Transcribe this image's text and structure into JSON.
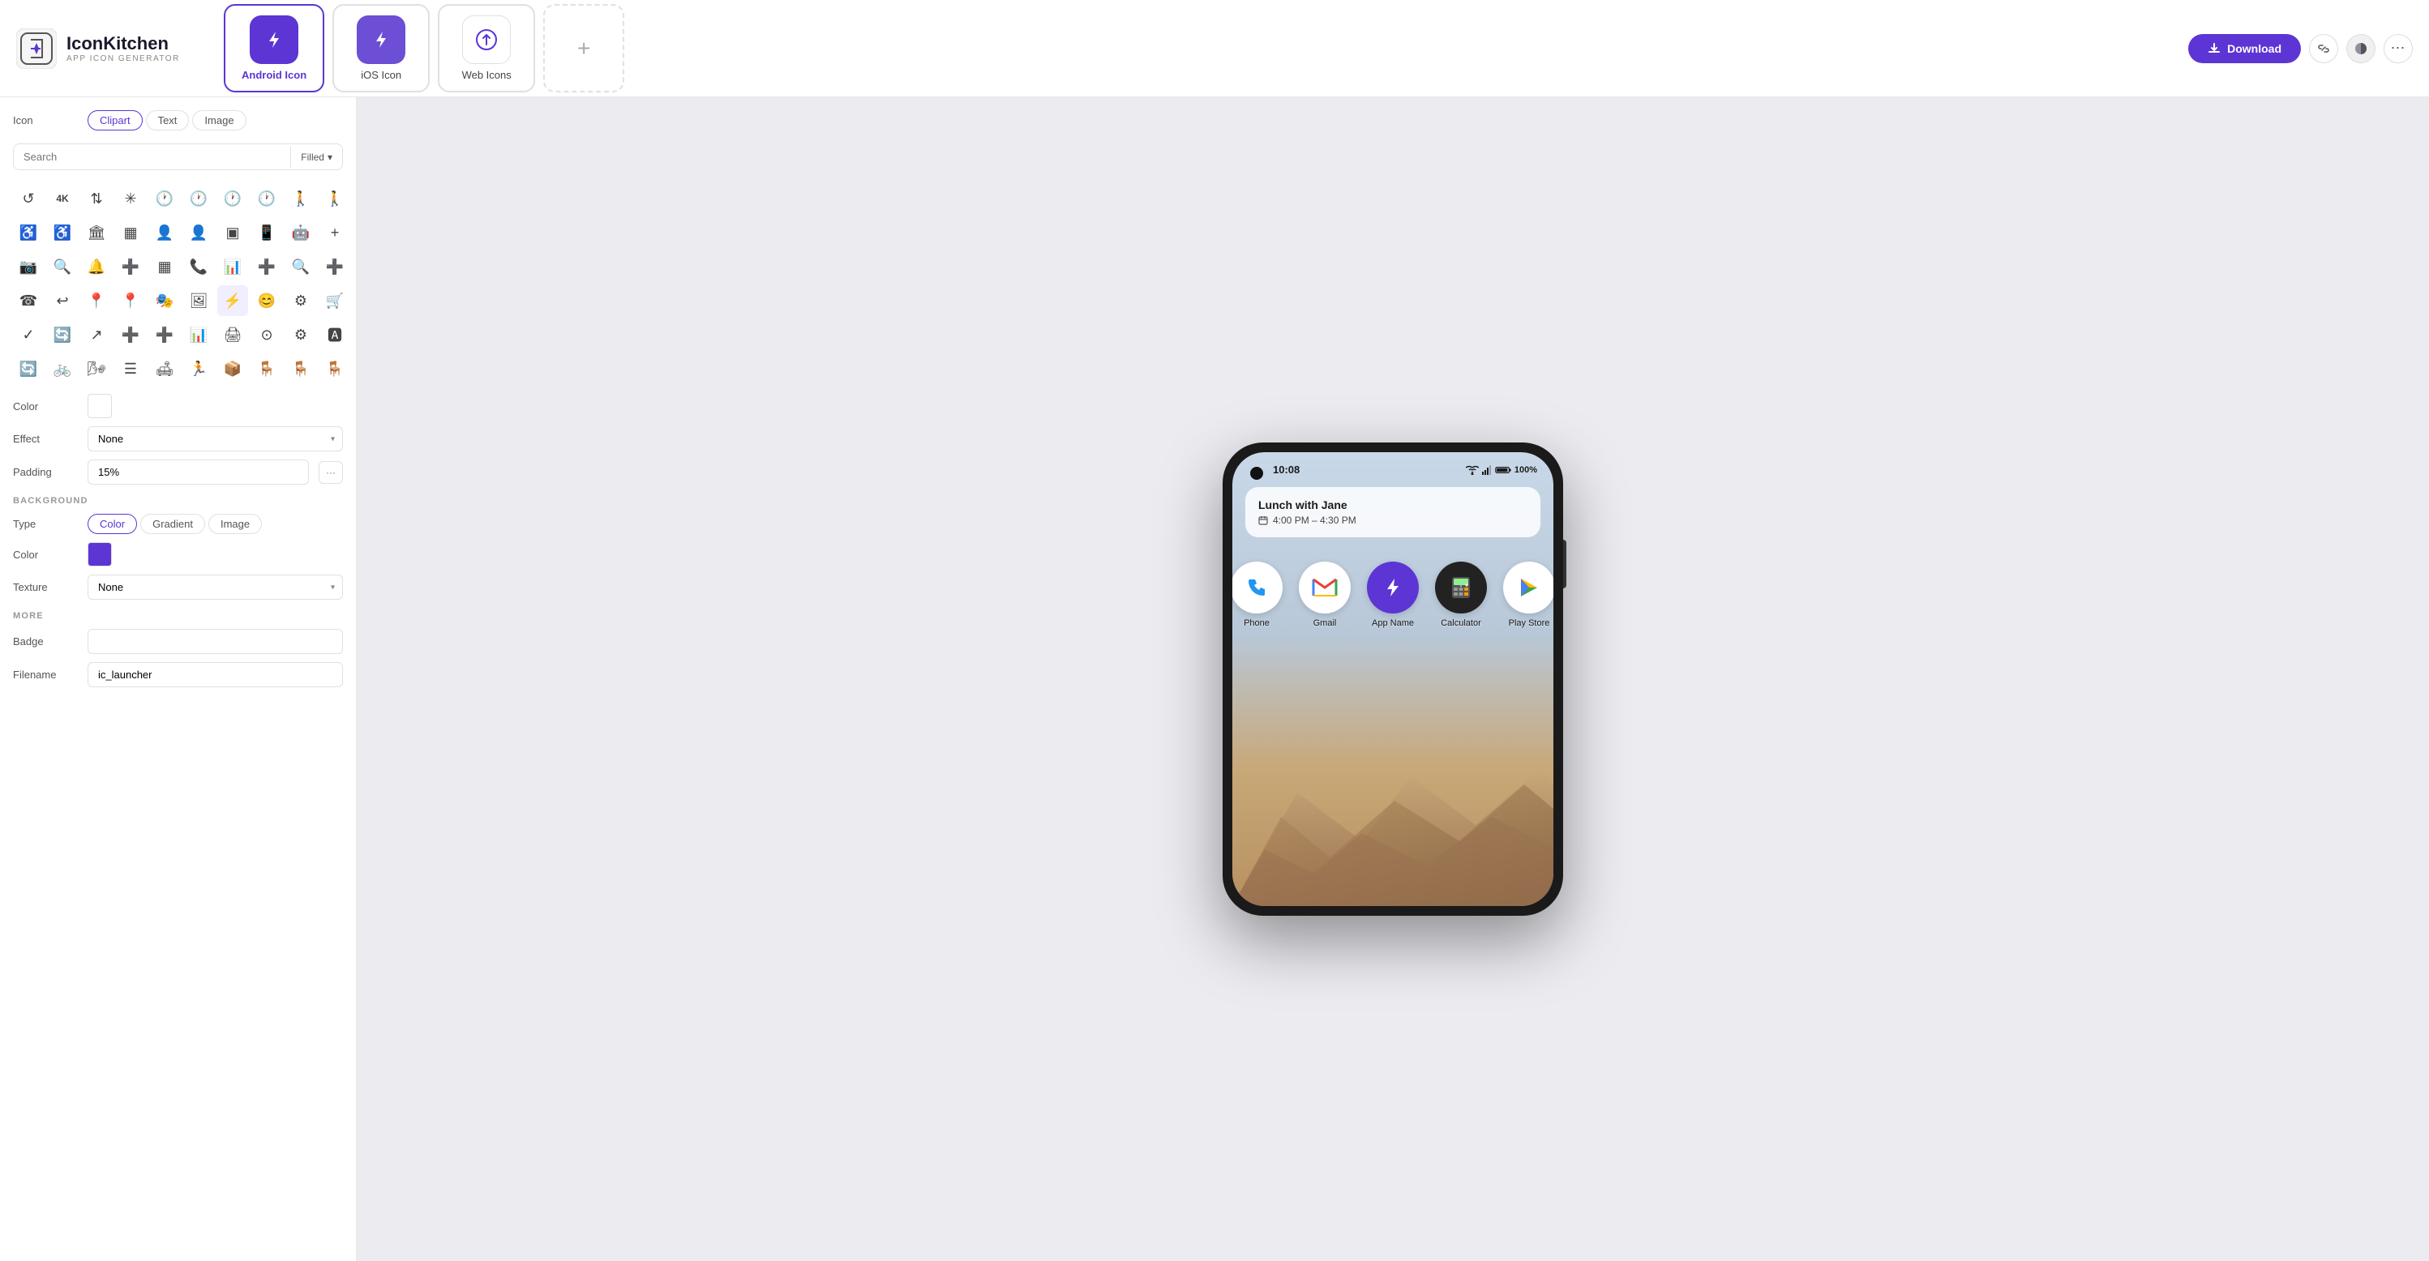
{
  "app": {
    "name": "IconKitchen",
    "subtitle": "APP ICON GENERATOR"
  },
  "header": {
    "tabs": [
      {
        "id": "android",
        "label": "Android Icon",
        "active": true,
        "icon": "⚡"
      },
      {
        "id": "ios",
        "label": "iOS Icon",
        "active": false,
        "icon": "⚡"
      },
      {
        "id": "web",
        "label": "Web Icons",
        "active": false,
        "icon": "⬆"
      }
    ],
    "add_label": "+",
    "download_label": "Download",
    "link_icon": "🔗",
    "theme_icon": "◑",
    "more_icon": "•••"
  },
  "sidebar": {
    "icon_section": {
      "label": "Icon",
      "tabs": [
        "Clipart",
        "Text",
        "Image"
      ],
      "active_tab": "Clipart"
    },
    "search": {
      "placeholder": "Search",
      "filter": "Filled"
    },
    "color_label": "Color",
    "effect_label": "Effect",
    "effect_value": "None",
    "padding_label": "Padding",
    "padding_value": "15%",
    "background_section": "BACKGROUND",
    "bg_type_label": "Type",
    "bg_types": [
      "Color",
      "Gradient",
      "Image"
    ],
    "bg_active_type": "Color",
    "bg_color_label": "Color",
    "texture_label": "Texture",
    "texture_value": "None",
    "more_section": "MORE",
    "badge_label": "Badge",
    "filename_label": "Filename",
    "filename_value": "ic_launcher"
  },
  "preview": {
    "phone": {
      "time": "10:08",
      "battery": "100%",
      "notification": {
        "title": "Lunch with Jane",
        "time": "4:00 PM – 4:30 PM"
      },
      "apps": [
        {
          "name": "Phone",
          "type": "phone"
        },
        {
          "name": "Gmail",
          "type": "gmail"
        },
        {
          "name": "App Name",
          "type": "custom"
        },
        {
          "name": "Calculator",
          "type": "calc"
        },
        {
          "name": "Play Store",
          "type": "playstore"
        }
      ]
    }
  }
}
